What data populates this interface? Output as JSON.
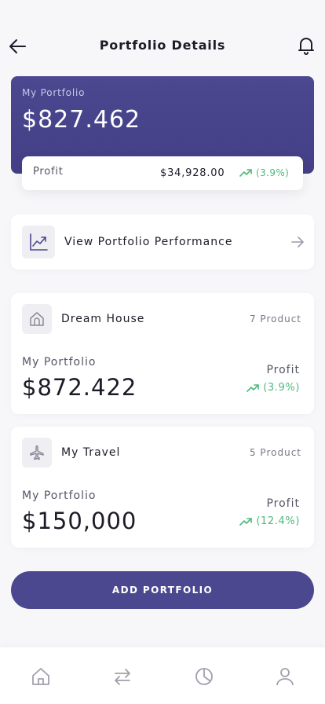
{
  "header": {
    "title": "Portfolio Details",
    "back_icon": "arrow-left-icon",
    "notification_icon": "bell-icon"
  },
  "summary": {
    "label": "My Portfolio",
    "value": "$827.462",
    "profit_label": "Profit",
    "profit_amount": "$34,928.00",
    "profit_change": "(3.9%)"
  },
  "performance": {
    "label": "View Portfolio Performance",
    "icon": "line-chart-icon"
  },
  "portfolios": [
    {
      "name": "Dream House",
      "count": "7 Product",
      "icon": "home-icon",
      "value_label": "My Portfolio",
      "value": "$872.422",
      "profit_label": "Profit",
      "profit_change": "(3.9%)"
    },
    {
      "name": "My Travel",
      "count": "5 Product",
      "icon": "airplane-icon",
      "value_label": "My Portfolio",
      "value": "$150,000",
      "profit_label": "Profit",
      "profit_change": "(12.4%)"
    }
  ],
  "actions": {
    "add_label": "ADD PORTFOLIO"
  },
  "tabbar": {
    "items": [
      "home-icon",
      "transfer-icon",
      "pie-chart-icon",
      "profile-icon"
    ]
  },
  "colors": {
    "primary": "#4b4890",
    "positive": "#4cb97d",
    "background": "#f7f7f9"
  }
}
